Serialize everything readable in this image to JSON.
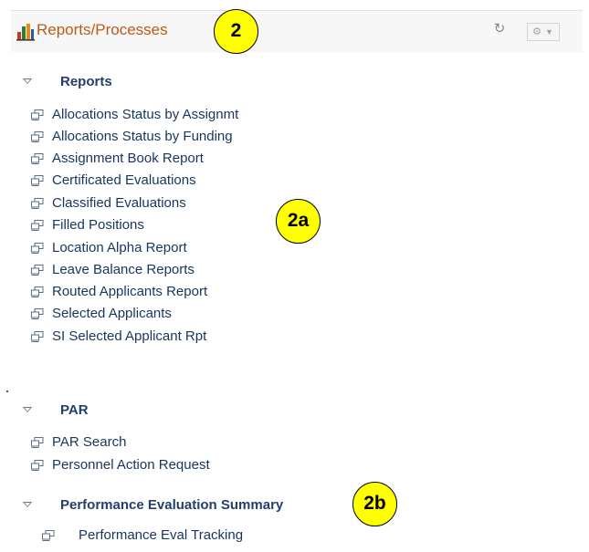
{
  "header": {
    "title": "Reports/Processes"
  },
  "sections": {
    "reports": {
      "label": "Reports",
      "items": [
        "Allocations Status by Assignmt",
        "Allocations Status by Funding",
        "Assignment Book Report",
        "Certificated Evaluations",
        "Classified Evaluations",
        "Filled Positions",
        "Location Alpha Report",
        "Leave Balance Reports",
        "Routed Applicants Report",
        "Selected Applicants",
        "SI Selected Applicant Rpt"
      ]
    },
    "par": {
      "label": "PAR",
      "items": [
        "PAR Search",
        "Personnel Action Request"
      ]
    },
    "perf": {
      "label": "Performance Evaluation Summary",
      "items": [
        "Performance Eval Tracking"
      ]
    }
  },
  "callouts": {
    "c2": "2",
    "c2a": "2a",
    "c2b": "2b"
  },
  "icons": {
    "header": "bar-chart-icon",
    "refresh": "refresh-icon",
    "settings": "gear-icon",
    "link": "report-link-icon",
    "collapse": "collapse-triangle-icon"
  }
}
